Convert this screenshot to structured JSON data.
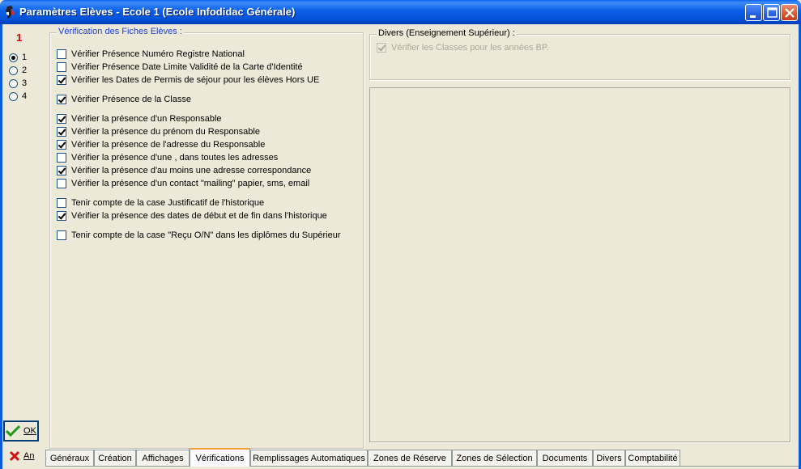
{
  "window": {
    "title": "Paramètres Elèves - Ecole 1 (Ecole Infodidac Générale)"
  },
  "left": {
    "school_number": "1",
    "radios": [
      {
        "label": "1",
        "checked": true
      },
      {
        "label": "2",
        "checked": false
      },
      {
        "label": "3",
        "checked": false
      },
      {
        "label": "4",
        "checked": false
      }
    ],
    "ok_label": "OK",
    "cancel_label": "An"
  },
  "verification": {
    "title": "Vérification des Fiches Elèves :",
    "items": [
      {
        "label": "Vérifier Présence Numéro Registre National",
        "checked": false
      },
      {
        "label": "Vérifier Présence Date Limite Validité de la Carte d'Identité",
        "checked": false
      },
      {
        "label": "Vérifier les Dates de Permis de séjour pour les élèves Hors UE",
        "checked": true
      },
      {
        "label": "Vérifier Présence de la Classe",
        "checked": true
      },
      {
        "label": "Vérifier la présence d'un Responsable",
        "checked": true
      },
      {
        "label": "Vérifier la présence du prénom du Responsable",
        "checked": true
      },
      {
        "label": "Vérifier la présence de l'adresse du Responsable",
        "checked": true
      },
      {
        "label": "Vérifier la présence d'une , dans toutes les adresses",
        "checked": false
      },
      {
        "label": "Vérifier la présence d'au moins une adresse correspondance",
        "checked": true
      },
      {
        "label": "Vérifier la présence d'un contact \"mailing\" papier, sms, email",
        "checked": false
      },
      {
        "label": "Tenir compte de la case Justificatif de l'historique",
        "checked": false
      },
      {
        "label": "Vérifier la présence des dates de début et de fin dans l'historique",
        "checked": true
      },
      {
        "label": "Tenir compte de la case \"Reçu O/N\" dans les diplômes du Supérieur",
        "checked": false
      }
    ]
  },
  "divers": {
    "title": "Divers (Enseignement Supérieur) :",
    "items": [
      {
        "label": "Vérifier les Classes pour les années BP.",
        "checked": true,
        "disabled": true
      }
    ]
  },
  "tabs": [
    {
      "label": "Généraux",
      "active": false
    },
    {
      "label": "Création",
      "active": false
    },
    {
      "label": "Affichages",
      "active": false
    },
    {
      "label": "Vérifications",
      "active": true
    },
    {
      "label": "Remplissages Automatiques",
      "active": false
    },
    {
      "label": "Zones de Réserve",
      "active": false
    },
    {
      "label": "Zones de Sélection",
      "active": false
    },
    {
      "label": "Documents",
      "active": false
    },
    {
      "label": "Divers",
      "active": false
    },
    {
      "label": "Comptabilité",
      "active": false
    }
  ],
  "colors": {
    "title_bar": "#0a5ae0",
    "group_title": "#1f3fd0",
    "school_number": "#e00000",
    "active_tab_accent": "#f2a23a"
  }
}
